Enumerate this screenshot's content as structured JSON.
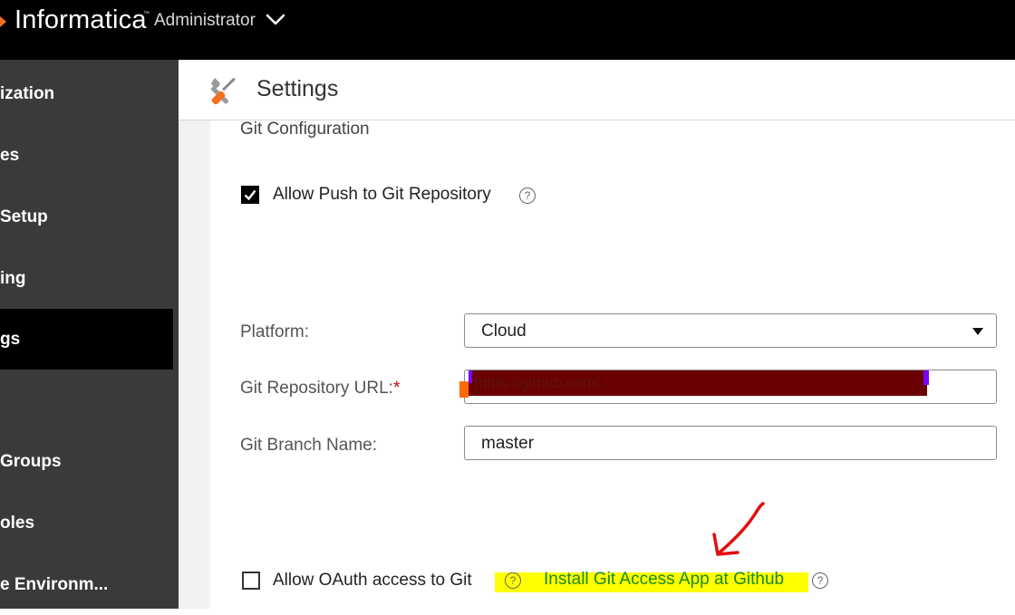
{
  "app": {
    "brand": "Informatica",
    "brand_tm": "™",
    "role": "Administrator"
  },
  "sidebar": {
    "items": [
      {
        "label": "Organization",
        "visible_text": "ization",
        "active": false
      },
      {
        "label": "Licenses",
        "visible_text": "es",
        "active": false
      },
      {
        "label": "Runtime Setup",
        "visible_text": "Setup",
        "active": false
      },
      {
        "label": "Metering",
        "visible_text": "ing",
        "active": false
      },
      {
        "label": "Settings",
        "visible_text": "gs",
        "active": true
      },
      {
        "label": "",
        "visible_text": "",
        "active": false
      },
      {
        "label": "User Groups",
        "visible_text": "Groups",
        "active": false
      },
      {
        "label": "User Roles",
        "visible_text": "oles",
        "active": false
      },
      {
        "label": "Runtime Environments",
        "visible_text": "e Environm...",
        "active": false
      }
    ]
  },
  "header": {
    "title": "Settings",
    "icon": "tools-icon"
  },
  "git_config": {
    "section_title": "Git Configuration",
    "allow_push": {
      "label": "Allow Push to Git Repository",
      "checked": true
    },
    "platform": {
      "label": "Platform:",
      "value": "Cloud"
    },
    "repo_url": {
      "label": "Git Repository URL:",
      "required_mark": "*",
      "value": "https://github.com/...",
      "redacted": true
    },
    "branch": {
      "label": "Git Branch Name:",
      "value": "master"
    },
    "allow_oauth": {
      "label": "Allow OAuth access to Git",
      "checked": false
    },
    "install_link": "Install Git Access App at Github",
    "help_glyph": "?"
  },
  "colors": {
    "topbar": "#000000",
    "sidebar": "#3a3a3a",
    "sidebar_active": "#000000",
    "link_green": "#1a8a1a",
    "highlight_yellow": "#ffff00",
    "annotation_red": "#e21010",
    "required_red": "#d0021b"
  }
}
